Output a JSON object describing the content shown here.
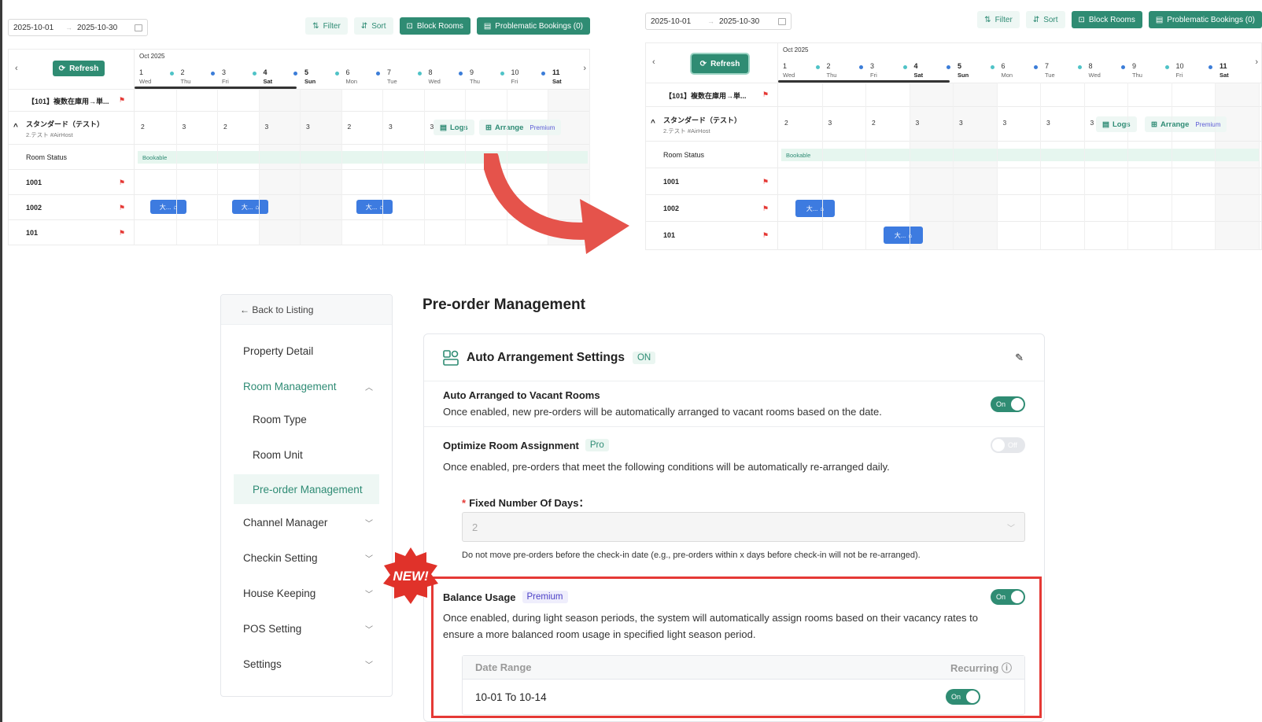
{
  "calendar_before": {
    "date_start": "2025-10-01",
    "date_end": "2025-10-30",
    "toolbar": {
      "filter": "Filter",
      "sort": "Sort",
      "block_rooms": "Block Rooms",
      "problematic": "Problematic Bookings  (0)"
    },
    "refresh": "Refresh",
    "month": "Oct 2025",
    "days": [
      {
        "n": "1",
        "w": "Wed"
      },
      {
        "n": "2",
        "w": "Thu"
      },
      {
        "n": "3",
        "w": "Fri"
      },
      {
        "n": "4",
        "w": "Sat"
      },
      {
        "n": "5",
        "w": "Sun"
      },
      {
        "n": "6",
        "w": "Mon"
      },
      {
        "n": "7",
        "w": "Tue"
      },
      {
        "n": "8",
        "w": "Wed"
      },
      {
        "n": "9",
        "w": "Thu"
      },
      {
        "n": "10",
        "w": "Fri"
      },
      {
        "n": "11",
        "w": "Sat"
      }
    ],
    "rows": {
      "r101title": "【101】複数在庫用→単...",
      "standard": "スタンダード（テスト）",
      "standard_sub": "2.テスト #AirHost",
      "room_status": "Room Status",
      "bookable": "Bookable",
      "r1001": "1001",
      "r1002": "1002",
      "r101": "101"
    },
    "counts": [
      "2",
      "3",
      "2",
      "3",
      "3",
      "2",
      "3",
      "3"
    ],
    "logs": "Logs",
    "arrange": "Arrange",
    "premium": "Premium",
    "chip_label": "大..."
  },
  "calendar_after": {
    "date_start": "2025-10-01",
    "date_end": "2025-10-30",
    "toolbar": {
      "filter": "Filter",
      "sort": "Sort",
      "block_rooms": "Block Rooms",
      "problematic": "Problematic Bookings  (0)"
    },
    "refresh": "Refresh",
    "month": "Oct 2025",
    "days": [
      {
        "n": "1",
        "w": "Wed"
      },
      {
        "n": "2",
        "w": "Thu"
      },
      {
        "n": "3",
        "w": "Fri"
      },
      {
        "n": "4",
        "w": "Sat"
      },
      {
        "n": "5",
        "w": "Sun"
      },
      {
        "n": "6",
        "w": "Mon"
      },
      {
        "n": "7",
        "w": "Tue"
      },
      {
        "n": "8",
        "w": "Wed"
      },
      {
        "n": "9",
        "w": "Thu"
      },
      {
        "n": "10",
        "w": "Fri"
      },
      {
        "n": "11",
        "w": "Sat"
      }
    ],
    "rows": {
      "r101title": "【101】複数在庫用→単...",
      "standard": "スタンダード（テスト）",
      "standard_sub": "2.テスト #AirHost",
      "room_status": "Room Status",
      "bookable": "Bookable",
      "r1001": "1001",
      "r1002": "1002",
      "r101": "101"
    },
    "counts": [
      "2",
      "3",
      "2",
      "3",
      "3",
      "3",
      "3",
      "3"
    ],
    "logs": "Logs",
    "arrange": "Arrange",
    "premium": "Premium",
    "chip_label": "大..."
  },
  "sidenav": {
    "back": "← Back to Listing",
    "items": {
      "property": "Property Detail",
      "room_mgmt": "Room Management",
      "room_type": "Room Type",
      "room_unit": "Room Unit",
      "preorder": "Pre-order Management",
      "channel": "Channel Manager",
      "checkin": "Checkin Setting",
      "house": "House Keeping",
      "pos": "POS Setting",
      "settings": "Settings"
    }
  },
  "main": {
    "title": "Pre-order Management",
    "card_title": "Auto Arrangement Settings",
    "card_status": "ON",
    "s1_title": "Auto Arranged to Vacant Rooms",
    "s1_desc": "Once enabled, new pre-orders will be automatically arranged to vacant rooms based on the date.",
    "s1_toggle": "On",
    "s2_title": "Optimize Room Assignment",
    "s2_badge": "Pro",
    "s2_toggle": "Off",
    "s2_desc": "Once enabled, pre-orders that meet the following conditions will be automatically re-arranged daily.",
    "field_label": "Fixed Number Of Days：",
    "field_value": "2",
    "field_hint": "Do not move pre-orders before the check-in date (e.g., pre-orders within x days before check-in will not be re-arranged).",
    "s3_title": "Balance Usage",
    "s3_badge": "Premium",
    "s3_toggle": "On",
    "s3_desc1": "Once enabled, during light season periods, the system will automatically assign rooms based on their vacancy rates to",
    "s3_desc2": "ensure a more balanced room usage in specified light season period.",
    "table_col1": "Date Range",
    "table_col2": "Recurring",
    "table_row_range": "10-01 To 10-14",
    "table_row_toggle": "On",
    "new_badge": "NEW!"
  },
  "colors": {
    "accent": "#2f8c73",
    "highlight": "#e53935",
    "chip": "#3d7be0"
  }
}
